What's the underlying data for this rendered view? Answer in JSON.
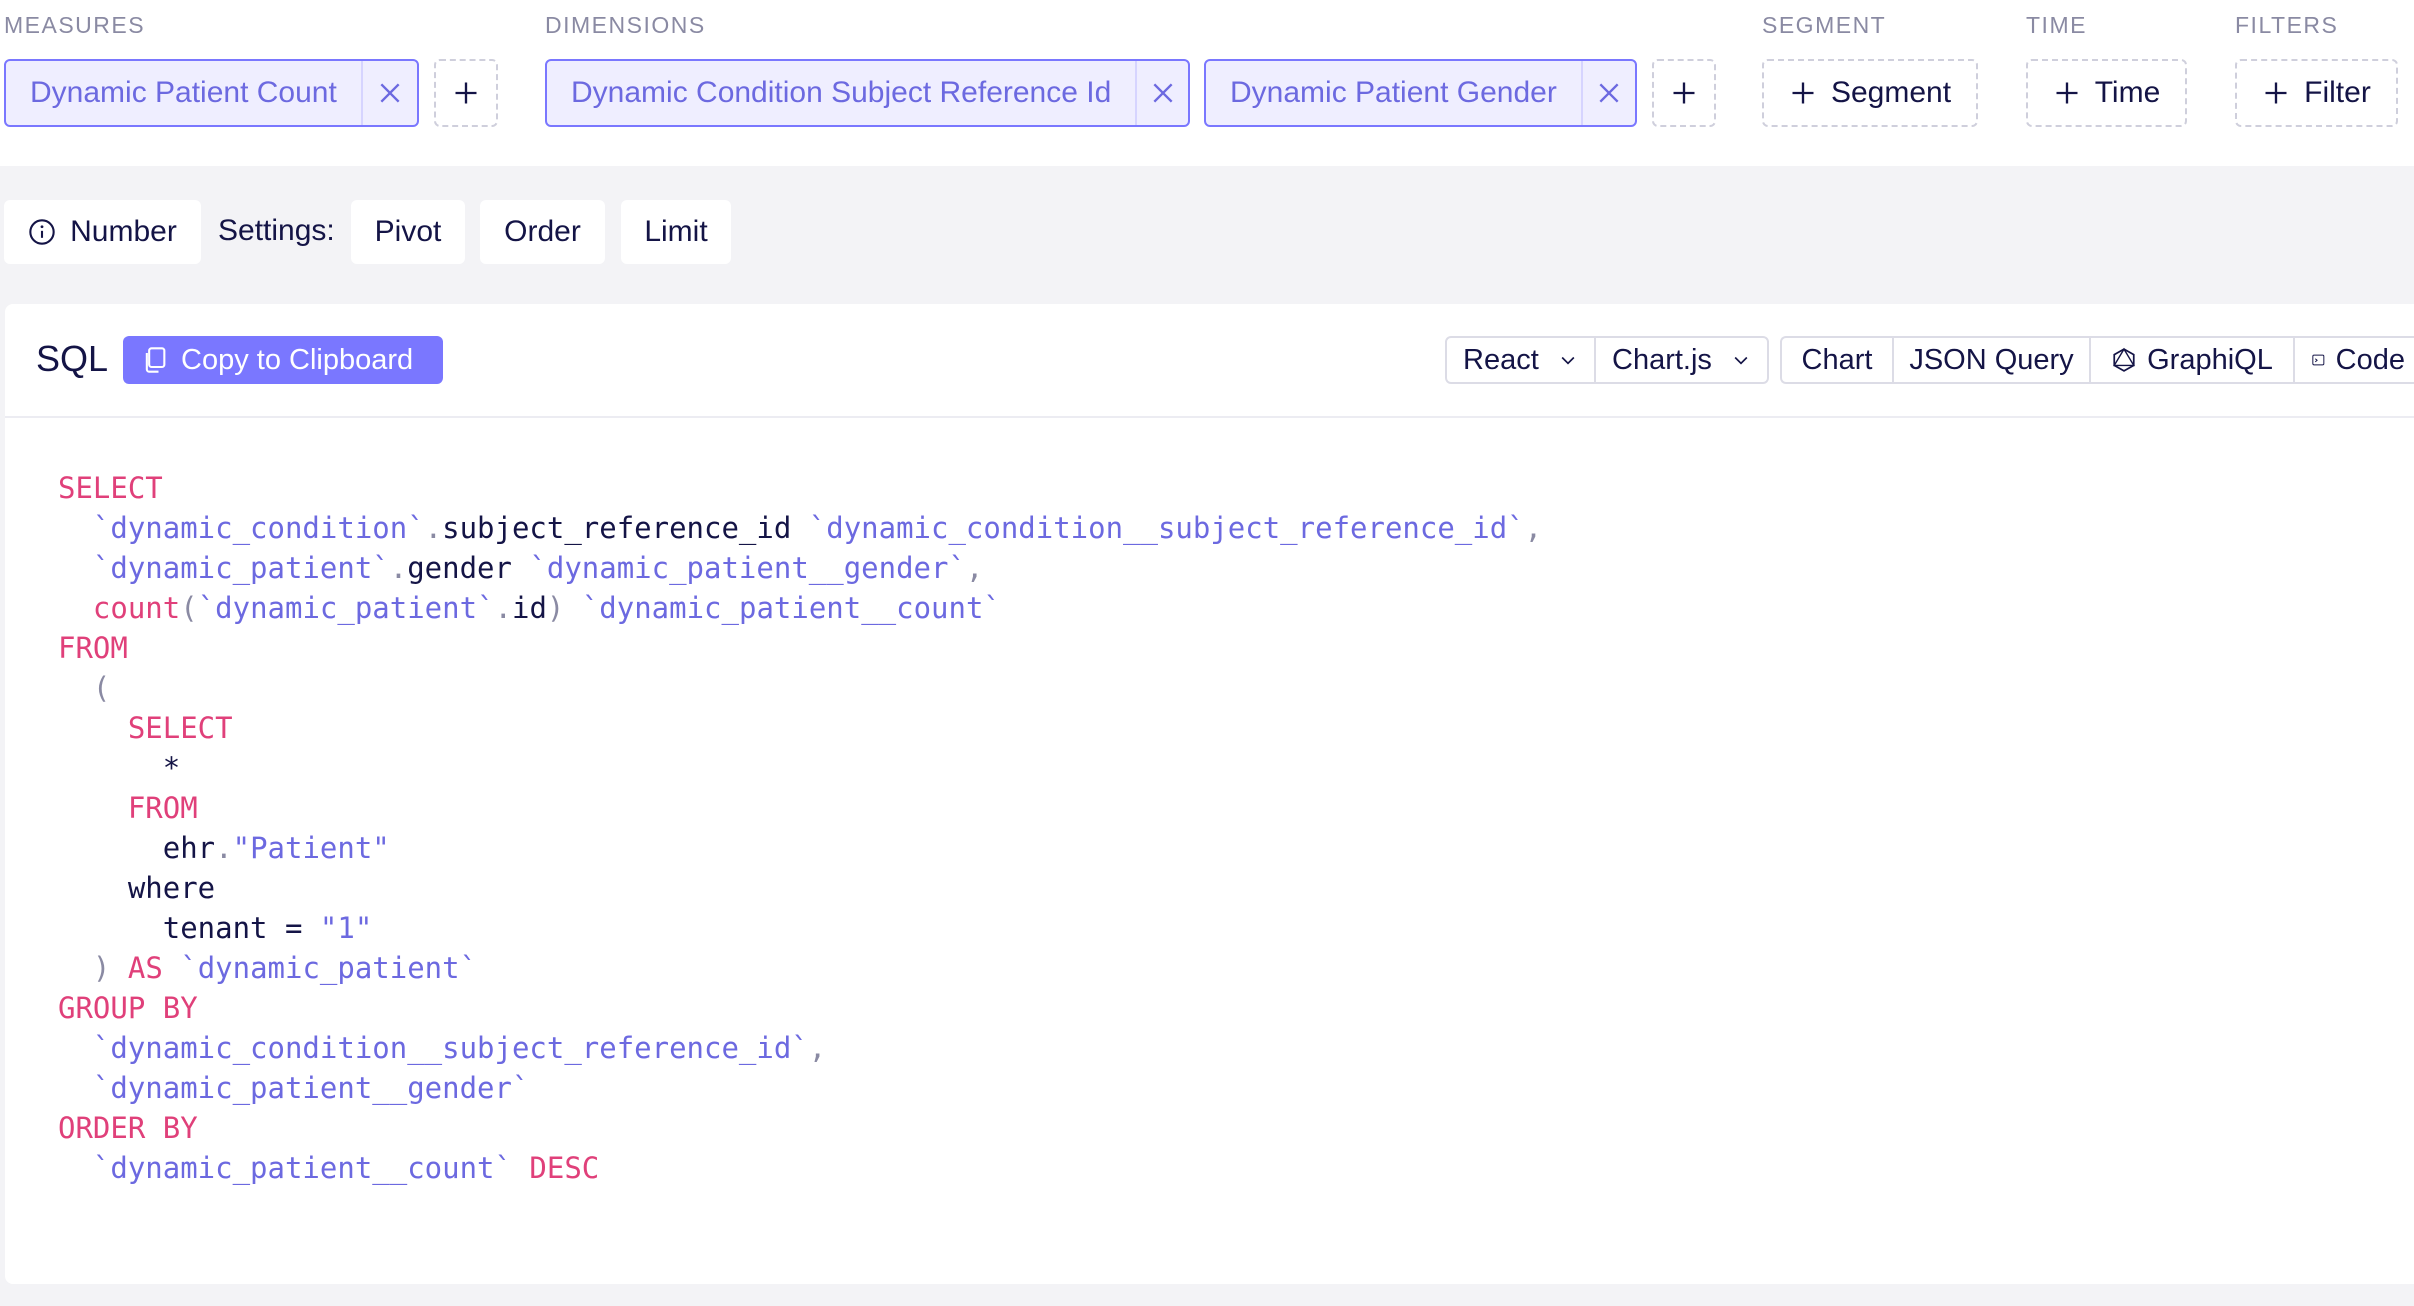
{
  "groups": {
    "measures": "MEASURES",
    "dimensions": "DIMENSIONS",
    "segment": "SEGMENT",
    "time": "TIME",
    "filters": "FILTERS"
  },
  "measures": [
    {
      "label": "Dynamic Patient Count"
    }
  ],
  "dimensions": [
    {
      "label": "Dynamic Condition Subject Reference Id"
    },
    {
      "label": "Dynamic Patient Gender"
    }
  ],
  "segment_button": "Segment",
  "time_button": "Time",
  "filter_button": "Filter",
  "settings": {
    "chart_type": "Number",
    "label": "Settings:",
    "pivot": "Pivot",
    "order": "Order",
    "limit": "Limit"
  },
  "sql_panel": {
    "title": "SQL",
    "copy_button": "Copy to Clipboard",
    "framework": "React",
    "library": "Chart.js",
    "tabs": [
      "Chart",
      "JSON Query",
      "GraphiQL",
      "Code"
    ]
  },
  "code_lines": [
    [
      [
        "kw",
        "SELECT"
      ]
    ],
    [
      [
        "pl",
        "  "
      ],
      [
        "id",
        "`dynamic_condition`"
      ],
      [
        "pn",
        "."
      ],
      [
        "pl",
        "subject_reference_id "
      ],
      [
        "id",
        "`dynamic_condition__subject_reference_id`"
      ],
      [
        "pn",
        ","
      ]
    ],
    [
      [
        "pl",
        "  "
      ],
      [
        "id",
        "`dynamic_patient`"
      ],
      [
        "pn",
        "."
      ],
      [
        "pl",
        "gender "
      ],
      [
        "id",
        "`dynamic_patient__gender`"
      ],
      [
        "pn",
        ","
      ]
    ],
    [
      [
        "pl",
        "  "
      ],
      [
        "kw",
        "count"
      ],
      [
        "pn",
        "("
      ],
      [
        "id",
        "`dynamic_patient`"
      ],
      [
        "pn",
        "."
      ],
      [
        "pl",
        "id"
      ],
      [
        "pn",
        ")"
      ],
      [
        "pl",
        " "
      ],
      [
        "id",
        "`dynamic_patient__count`"
      ]
    ],
    [
      [
        "kw",
        "FROM"
      ]
    ],
    [
      [
        "pl",
        "  "
      ],
      [
        "pn",
        "("
      ]
    ],
    [
      [
        "pl",
        "    "
      ],
      [
        "kw",
        "SELECT"
      ]
    ],
    [
      [
        "pl",
        "      *"
      ]
    ],
    [
      [
        "pl",
        "    "
      ],
      [
        "kw",
        "FROM"
      ]
    ],
    [
      [
        "pl",
        "      ehr"
      ],
      [
        "pn",
        "."
      ],
      [
        "id",
        "\"Patient\""
      ]
    ],
    [
      [
        "pl",
        "    where"
      ]
    ],
    [
      [
        "pl",
        "      tenant = "
      ],
      [
        "id",
        "\"1\""
      ]
    ],
    [
      [
        "pl",
        "  "
      ],
      [
        "pn",
        ")"
      ],
      [
        "pl",
        " "
      ],
      [
        "kw",
        "AS"
      ],
      [
        "pl",
        " "
      ],
      [
        "id",
        "`dynamic_patient`"
      ]
    ],
    [
      [
        "kw",
        "GROUP BY"
      ]
    ],
    [
      [
        "pl",
        "  "
      ],
      [
        "id",
        "`dynamic_condition__subject_reference_id`"
      ],
      [
        "pn",
        ","
      ]
    ],
    [
      [
        "pl",
        "  "
      ],
      [
        "id",
        "`dynamic_patient__gender`"
      ]
    ],
    [
      [
        "kw",
        "ORDER BY"
      ]
    ],
    [
      [
        "pl",
        "  "
      ],
      [
        "id",
        "`dynamic_patient__count`"
      ],
      [
        "pl",
        " "
      ],
      [
        "kw",
        "DESC"
      ]
    ]
  ],
  "colors": {
    "accent": "#7a77ff",
    "keyword": "#e0407a",
    "identifier": "#6c69e0"
  }
}
